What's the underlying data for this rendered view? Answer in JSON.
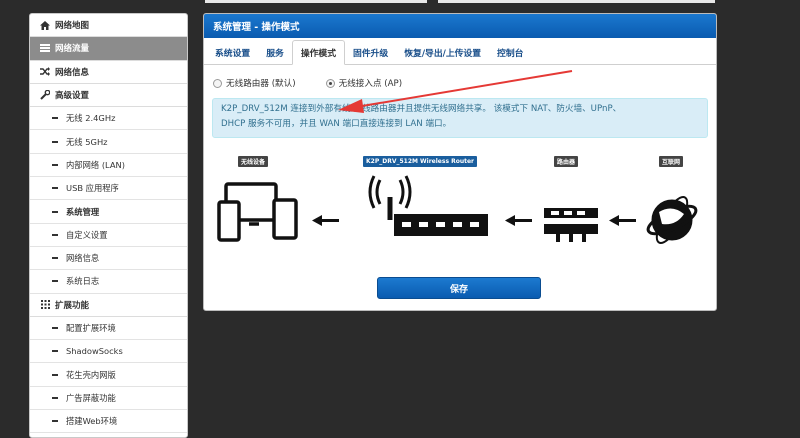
{
  "sidebar": {
    "items": [
      {
        "label": "网络地图",
        "icon": "home-icon"
      },
      {
        "label": "网络流量",
        "icon": "list-icon"
      },
      {
        "label": "网络信息",
        "icon": "shuffle-icon"
      },
      {
        "label": "高级设置",
        "icon": "wrench-icon"
      }
    ],
    "sub_items": [
      "无线 2.4GHz",
      "无线 5GHz",
      "内部网络 (LAN)",
      "USB 应用程序",
      "系统管理",
      "自定义设置",
      "网络信息",
      "系统日志"
    ],
    "ext": {
      "label": "扩展功能",
      "icon": "grid-icon"
    },
    "ext_items": [
      "配置扩展环境",
      "ShadowSocks",
      "花生壳内网版",
      "广告屏蔽功能",
      "搭建Web环境"
    ]
  },
  "panel": {
    "title": "系统管理 - 操作模式",
    "tabs": [
      "系统设置",
      "服务",
      "操作模式",
      "固件升级",
      "恢复/导出/上传设置",
      "控制台"
    ],
    "radios": [
      {
        "label": "无线路由器 (默认)",
        "checked": false
      },
      {
        "label": "无线接入点 (AP)",
        "checked": true
      }
    ],
    "info_line1": "K2P_DRV_512M 连接到外部有线/无线路由器并且提供无线网络共享。 该模式下 NAT、防火墙、UPnP、",
    "info_line2": "DHCP 服务不可用，并且 WAN 端口直接连接到 LAN 端口。",
    "diagram": {
      "client_tag": "无线设备",
      "router_tag": "K2P_DRV_512M Wireless Router",
      "upstream_tag": "路由器",
      "internet_tag": "互联网"
    },
    "save_label": "保存"
  },
  "colors": {
    "header_blue": "#0a5bb0",
    "info_bg": "#d9edf7",
    "info_text": "#31708f",
    "annotation_arrow": "#e53935"
  }
}
